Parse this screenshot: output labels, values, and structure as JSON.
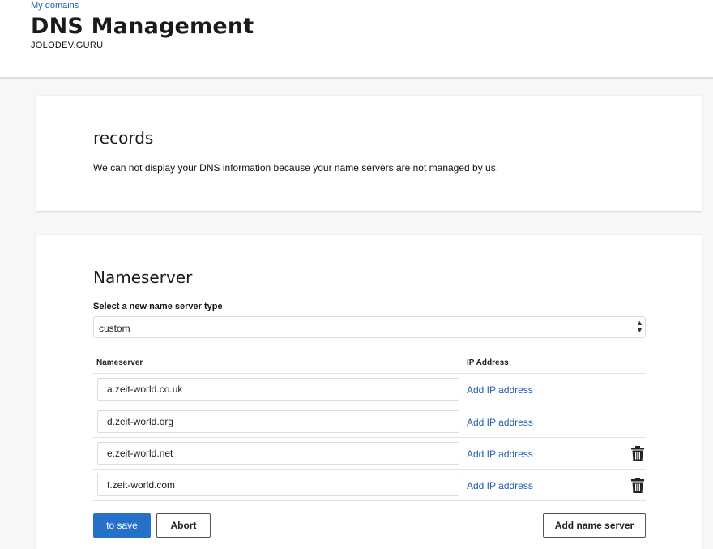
{
  "header": {
    "breadcrumb": "My domains",
    "title": "DNS Management",
    "domain": "JOLODEV.GURU"
  },
  "records": {
    "title": "records",
    "message": "We can not display your DNS information because your name servers are not managed by us."
  },
  "nameserver": {
    "title": "Nameserver",
    "select_label": "Select a new name server type",
    "select_value": "custom",
    "col_nameserver": "Nameserver",
    "col_ip": "IP Address",
    "rows": [
      {
        "value": "a.zeit-world.co.uk",
        "ip_link": "Add IP address",
        "deletable": false
      },
      {
        "value": "d.zeit-world.org",
        "ip_link": "Add IP address",
        "deletable": false
      },
      {
        "value": "e.zeit-world.net",
        "ip_link": "Add IP address",
        "deletable": true
      },
      {
        "value": "f.zeit-world.com",
        "ip_link": "Add IP address",
        "deletable": true
      }
    ],
    "save_label": "to save",
    "abort_label": "Abort",
    "add_label": "Add name server"
  },
  "colors": {
    "link": "#1f5fa8",
    "primary_button": "#2670c9",
    "background": "#f5f7f8"
  },
  "icons": {
    "select_arrows": "updown-arrows-icon",
    "delete": "trash-icon"
  }
}
